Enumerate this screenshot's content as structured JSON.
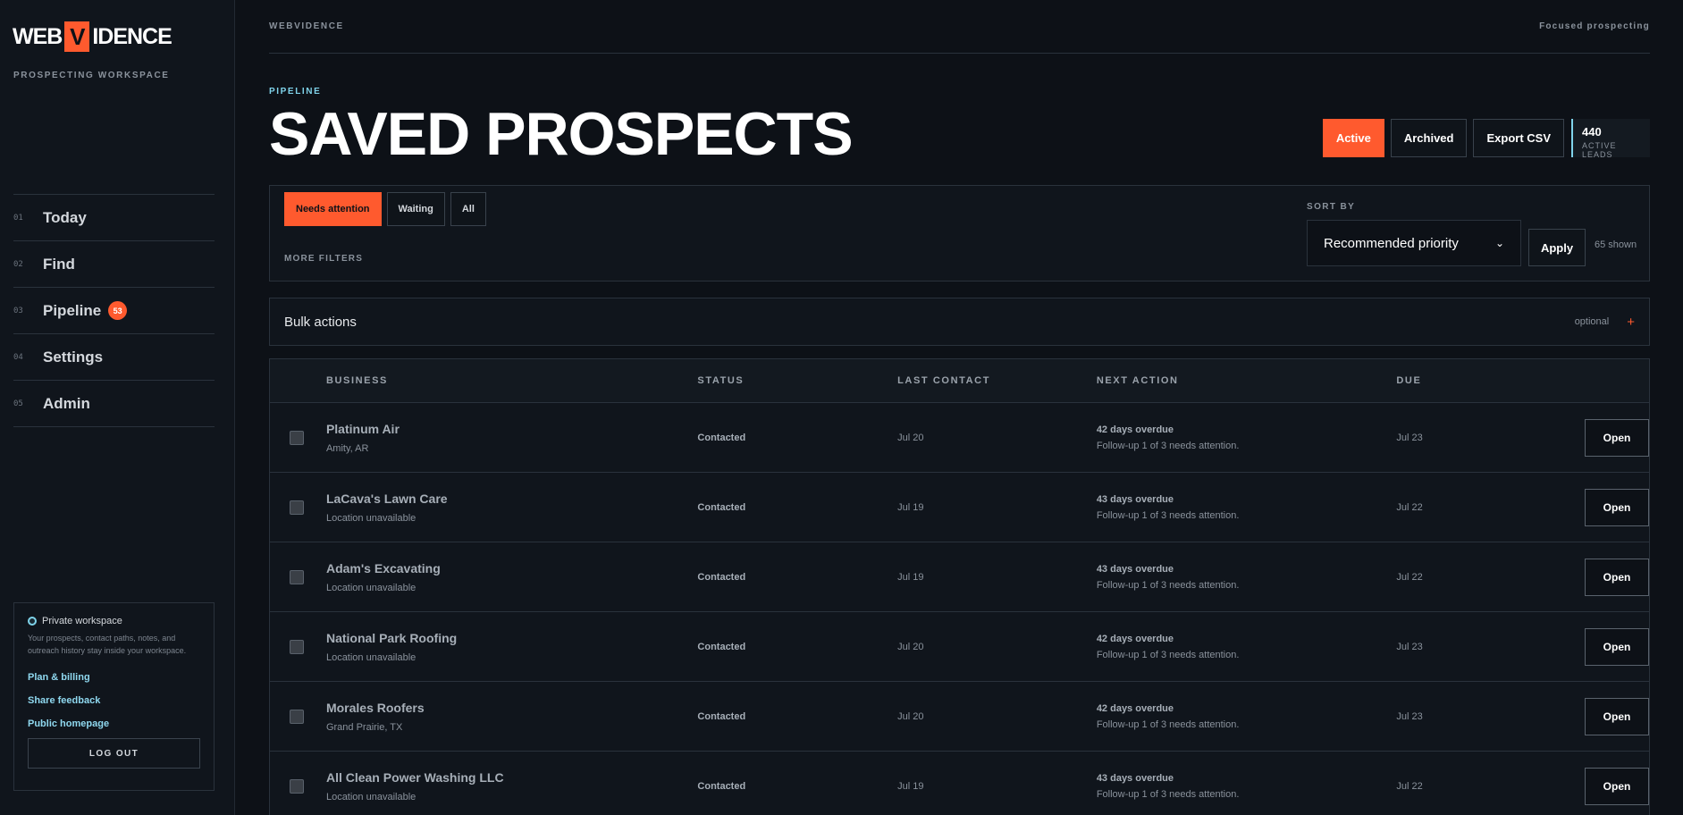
{
  "sidebar": {
    "logo_left": "WEB",
    "logo_mark": "V",
    "logo_right": "IDENCE",
    "workspace_label": "PROSPECTING WORKSPACE",
    "nav": [
      {
        "num": "01",
        "label": "Today"
      },
      {
        "num": "02",
        "label": "Find"
      },
      {
        "num": "03",
        "label": "Pipeline",
        "badge": "53"
      },
      {
        "num": "04",
        "label": "Settings"
      },
      {
        "num": "05",
        "label": "Admin"
      }
    ],
    "privacy": {
      "title": "Private workspace",
      "text": "Your prospects, contact paths, notes, and outreach history stay inside your workspace."
    },
    "links": [
      "Plan & billing",
      "Share feedback",
      "Public homepage"
    ],
    "logout": "LOG OUT"
  },
  "topbar": {
    "brand": "WEBVIDENCE",
    "tagline": "Focused prospecting"
  },
  "header": {
    "kicker": "PIPELINE",
    "title": "SAVED PROSPECTS",
    "views": {
      "active": "Active",
      "archived": "Archived",
      "export": "Export CSV"
    },
    "stat": {
      "value": "440",
      "label": "ACTIVE LEADS"
    }
  },
  "filters": {
    "chips": {
      "needs": "Needs attention",
      "waiting": "Waiting",
      "all": "All"
    },
    "more": "MORE FILTERS",
    "sort_label": "SORT BY",
    "sort_value": "Recommended priority",
    "apply": "Apply",
    "shown": "65 shown"
  },
  "bulk": {
    "title": "Bulk actions",
    "optional": "optional",
    "plus": "+"
  },
  "table": {
    "headers": {
      "business": "BUSINESS",
      "status": "STATUS",
      "last": "LAST CONTACT",
      "next": "NEXT ACTION",
      "due": "DUE"
    },
    "open_label": "Open",
    "rows": [
      {
        "name": "Platinum Air",
        "location": "Amity, AR",
        "status": "Contacted",
        "last": "Jul 20",
        "next_title": "42 days overdue",
        "next_sub": "Follow-up 1 of 3 needs attention.",
        "due": "Jul 23"
      },
      {
        "name": "LaCava's Lawn Care",
        "location": "Location unavailable",
        "status": "Contacted",
        "last": "Jul 19",
        "next_title": "43 days overdue",
        "next_sub": "Follow-up 1 of 3 needs attention.",
        "due": "Jul 22"
      },
      {
        "name": "Adam's Excavating",
        "location": "Location unavailable",
        "status": "Contacted",
        "last": "Jul 19",
        "next_title": "43 days overdue",
        "next_sub": "Follow-up 1 of 3 needs attention.",
        "due": "Jul 22"
      },
      {
        "name": "National Park Roofing",
        "location": "Location unavailable",
        "status": "Contacted",
        "last": "Jul 20",
        "next_title": "42 days overdue",
        "next_sub": "Follow-up 1 of 3 needs attention.",
        "due": "Jul 23"
      },
      {
        "name": "Morales Roofers",
        "location": "Grand Prairie, TX",
        "status": "Contacted",
        "last": "Jul 20",
        "next_title": "42 days overdue",
        "next_sub": "Follow-up 1 of 3 needs attention.",
        "due": "Jul 23"
      },
      {
        "name": "All Clean Power Washing LLC",
        "location": "Location unavailable",
        "status": "Contacted",
        "last": "Jul 19",
        "next_title": "43 days overdue",
        "next_sub": "Follow-up 1 of 3 needs attention.",
        "due": "Jul 22"
      }
    ]
  },
  "colors": {
    "accent": "#ff5a2e",
    "link": "#8fd8ef",
    "background": "#0d1117"
  }
}
